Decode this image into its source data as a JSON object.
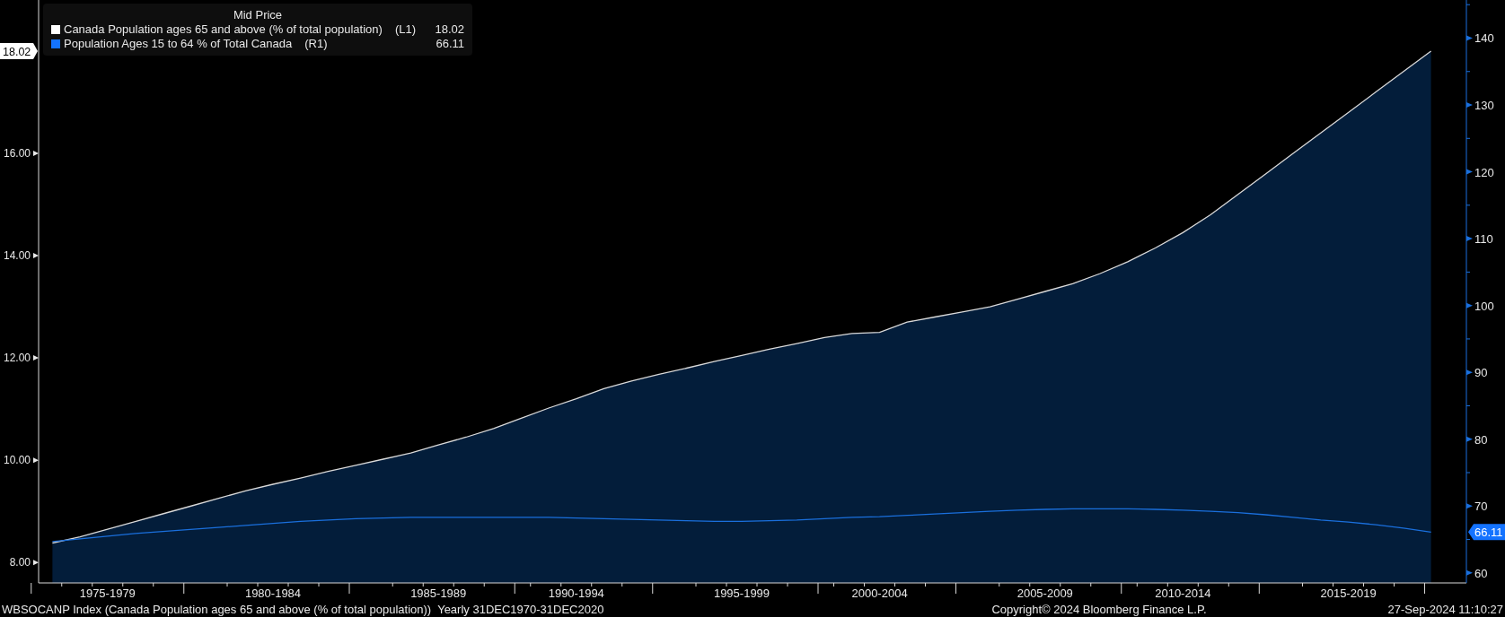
{
  "legend": {
    "title": "Mid Price",
    "items": [
      {
        "axis": "(L1)",
        "value": "18.02",
        "color": "#ffffff"
      },
      {
        "axis": "(R1)",
        "value": "66.11",
        "color": "#1473ff"
      }
    ]
  },
  "left_axis_chart": {
    "last_value_badge": "18.02",
    "chart_data": {
      "type": "area",
      "categories": [
        null,
        null,
        "1975-1979",
        null,
        null,
        null,
        null,
        null,
        "1980-1984",
        null,
        null,
        null,
        null,
        null,
        "1985-1989",
        null,
        null,
        null,
        null,
        "1990-1994",
        null,
        null,
        null,
        null,
        null,
        "1995-1999",
        null,
        null,
        null,
        null,
        "2000-2004",
        null,
        null,
        null,
        null,
        null,
        "2005-2009",
        null,
        null,
        null,
        null,
        "2010-2014",
        null,
        null,
        null,
        null,
        null,
        "2015-2019",
        null,
        null,
        null
      ],
      "series": [
        {
          "name": "Canada Population ages 65 and above (% of total population)",
          "color": "#d9d9d9",
          "values": [
            8.38,
            8.5,
            8.65,
            8.8,
            8.95,
            9.1,
            9.25,
            9.4,
            9.53,
            9.65,
            9.78,
            9.9,
            10.02,
            10.14,
            10.3,
            10.45,
            10.62,
            10.82,
            11.02,
            11.2,
            11.4,
            11.55,
            11.68,
            11.8,
            11.93,
            12.05,
            12.17,
            12.28,
            12.4,
            12.48,
            12.5,
            12.7,
            12.8,
            12.9,
            13.0,
            13.15,
            13.3,
            13.45,
            13.65,
            13.88,
            14.15,
            14.45,
            14.8,
            15.2,
            15.6,
            16.0,
            16.4,
            16.8,
            17.2,
            17.6,
            18.0
          ]
        }
      ],
      "ylim": [
        7.6,
        19.0
      ],
      "yticks": [
        {
          "value": 8,
          "label": "8.00"
        },
        {
          "value": 10,
          "label": "10.00"
        },
        {
          "value": 12,
          "label": "12.00"
        },
        {
          "value": 14,
          "label": "14.00"
        },
        {
          "value": 16,
          "label": "16.00"
        }
      ]
    }
  },
  "right_axis_chart": {
    "last_value_badge": "66.11",
    "chart_data": {
      "type": "line",
      "categories": [
        null,
        null,
        null,
        null,
        null,
        null,
        null,
        null,
        null,
        null,
        null,
        null,
        null,
        null,
        null,
        null,
        null,
        null,
        null,
        null,
        null,
        null,
        null,
        null,
        null,
        null,
        null,
        null,
        null,
        null,
        null,
        null,
        null,
        null,
        null,
        null,
        null,
        null,
        null,
        null,
        null,
        null,
        null,
        null,
        null,
        null,
        null,
        null,
        null,
        null,
        null
      ],
      "series": [
        {
          "name": "Population Ages 15 to 64 % of Total Canada",
          "color": "#1a6fdc",
          "values": [
            64.7,
            65.1,
            65.5,
            65.9,
            66.2,
            66.5,
            66.8,
            67.1,
            67.4,
            67.7,
            67.9,
            68.1,
            68.2,
            68.3,
            68.3,
            68.3,
            68.3,
            68.3,
            68.3,
            68.2,
            68.1,
            68.0,
            67.9,
            67.8,
            67.7,
            67.7,
            67.8,
            67.9,
            68.1,
            68.3,
            68.4,
            68.6,
            68.8,
            69.0,
            69.2,
            69.4,
            69.5,
            69.6,
            69.6,
            69.6,
            69.5,
            69.4,
            69.2,
            69.0,
            68.7,
            68.3,
            67.9,
            67.6,
            67.2,
            66.7,
            66.1
          ]
        }
      ],
      "ylim": [
        58.5,
        145.7
      ],
      "yticks": [
        60,
        70,
        80,
        90,
        100,
        110,
        120,
        130,
        140
      ]
    }
  },
  "footer": {
    "description": "WBSOCANP Index (Canada Population ages 65 and above (% of total population))  Yearly 31DEC1970-31DEC2020",
    "copyright": "Copyright© 2024 Bloomberg Finance L.P.",
    "timestamp": "27-Sep-2024 11:10:27"
  }
}
